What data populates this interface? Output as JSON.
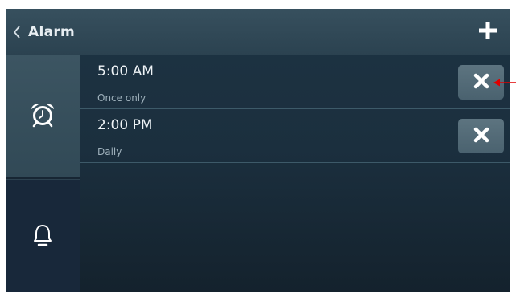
{
  "header": {
    "back_label": "Alarm",
    "back_icon": "chevron-left-icon",
    "add_icon": "plus-icon"
  },
  "sidebar": {
    "tabs": [
      {
        "name": "alarm-clock",
        "icon": "alarm-clock-icon",
        "active": true
      },
      {
        "name": "notifications",
        "icon": "bell-icon",
        "active": false
      }
    ]
  },
  "alarms": [
    {
      "time": "5:00 AM",
      "repeat": "Once only",
      "delete_icon": "close-icon"
    },
    {
      "time": "2:00 PM",
      "repeat": "Daily",
      "delete_icon": "close-icon"
    }
  ],
  "colors": {
    "annotation_arrow": "#e00000",
    "text_primary": "#eef3f6",
    "text_secondary": "#9eb0bb"
  }
}
